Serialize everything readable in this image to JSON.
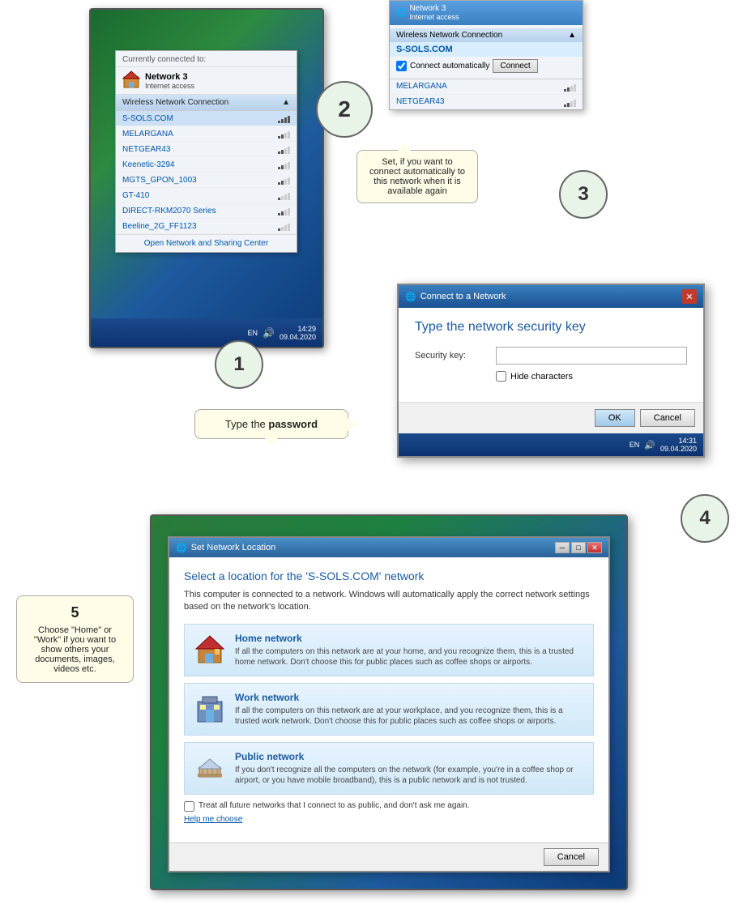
{
  "step1": {
    "currently_connected_label": "Currently connected to:",
    "network_name": "Network 3",
    "network_sub": "Internet access",
    "wireless_header": "Wireless Network Connection",
    "networks": [
      {
        "name": "S-SOLS.COM",
        "signal": 4
      },
      {
        "name": "MELARGANA",
        "signal": 3
      },
      {
        "name": "NETGEAR43",
        "signal": 3
      },
      {
        "name": "Keenetic-3294",
        "signal": 2
      },
      {
        "name": "MGTS_GPON_1003",
        "signal": 2
      },
      {
        "name": "GT-410",
        "signal": 2
      },
      {
        "name": "DIRECT-RKM2070 Series",
        "signal": 2
      },
      {
        "name": "Beeline_2G_FF1123",
        "signal": 1
      }
    ],
    "open_network_center": "Open Network and Sharing Center",
    "taskbar_lang": "EN",
    "taskbar_time": "14:29",
    "taskbar_date": "09.04.2020"
  },
  "step2": {
    "header_title": "Network 3",
    "header_sub": "Internet access",
    "wireless_label": "Wireless Network Connection",
    "selected_network": "S-SOLS.COM",
    "connect_auto_label": "Connect automatically",
    "connect_btn": "Connect",
    "other_network1": "MELARGANA",
    "other_network2": "NETGEAR43"
  },
  "step3": {
    "set_annotation": "Set, if you want to connect automatically to this network when it is available again"
  },
  "step4": {
    "title": "Connect to a Network",
    "heading": "Type the network security key",
    "security_key_label": "Security key:",
    "hide_characters_label": "Hide characters",
    "ok_btn": "OK",
    "cancel_btn": "Cancel",
    "taskbar_lang": "EN",
    "taskbar_time": "14:31",
    "taskbar_date": "09.04.2020"
  },
  "step5": {
    "title": "Set Network Location",
    "heading": "Select a location for the 'S-SOLS.COM' network",
    "description": "This computer is connected to a network. Windows will automatically apply the correct network settings based on the network's location.",
    "home_network_title": "Home network",
    "home_network_desc": "If all the computers on this network are at your home, and you recognize them, this is a trusted home network.  Don't choose this for public places such as coffee shops or airports.",
    "work_network_title": "Work network",
    "work_network_desc": "If all the computers on this network are at your workplace, and you recognize them, this is a trusted work network.  Don't choose this for public places such as coffee shops or airports.",
    "public_network_title": "Public network",
    "public_network_desc": "If you don't recognize all the computers on the network (for example, you're in a coffee shop or airport, or you have mobile broadband), this is a public network and is not trusted.",
    "checkbox_label": "Treat all future networks that I connect to as public, and don't ask me again.",
    "help_link": "Help me choose",
    "cancel_btn": "Cancel"
  },
  "callouts": {
    "c1": "1",
    "c2": "2",
    "c3": "3",
    "c4": "4",
    "c5": "5",
    "c5_text": "Choose \"Home\" or \"Work\" if you want to show others your documents, images, videos etc."
  },
  "password_bubble": {
    "prefix": "Type the ",
    "bold_word": "password"
  }
}
